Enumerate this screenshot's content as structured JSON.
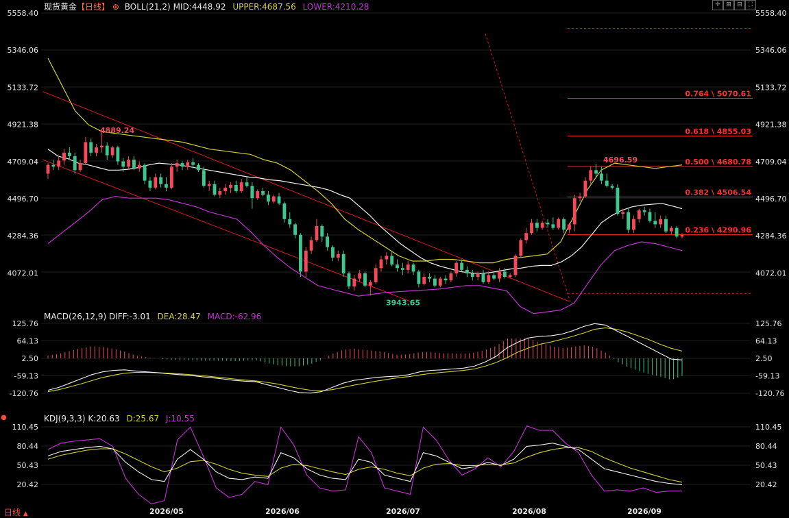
{
  "header": {
    "instrument": "现货黄金",
    "period": "【日线】",
    "settings_glyph": "⊕",
    "boll": {
      "label": "BOLL(21,2)",
      "mid_label": "MID:4448.92",
      "upper_label": "UPPER:4687.56",
      "lower_label": "LOWER:4210.28"
    }
  },
  "colors": {
    "up": "#f24a5a",
    "down": "#3fc68f",
    "mid": "#f2f2f2",
    "upper": "#d6d030",
    "lower": "#c631d6",
    "fib": "#ff2222",
    "grid": "#1e1e1e",
    "bg": "#000000"
  },
  "main_panel": {
    "price_ticks": [
      "5558.40",
      "5346.06",
      "5133.72",
      "4921.38",
      "4709.04",
      "4496.70",
      "4284.36",
      "4072.01"
    ],
    "annotations": {
      "high_label": "4889.24",
      "low_label": "3943.65",
      "swing_high_label": "4696.59"
    },
    "fib_levels": [
      {
        "label": "0.764 \\ 5070.61",
        "price": 5070.61
      },
      {
        "label": "0.618 \\ 4855.03",
        "price": 4855.03
      },
      {
        "label": "0.500 \\ 4680.78",
        "price": 4680.78
      },
      {
        "label": "0.382 \\ 4506.54",
        "price": 4506.54
      },
      {
        "label": "0.236 \\ 4290.96",
        "price": 4290.96
      }
    ]
  },
  "macd_panel": {
    "label": "MACD(26,12,9)",
    "diff_label": "DIFF:-3.01",
    "dea_label": "DEA:28.47",
    "macd_label": "MACD:-62.96",
    "ticks": [
      "125.76",
      "64.13",
      "2.50",
      "-59.13",
      "-120.76"
    ]
  },
  "kdj_panel": {
    "label": "KDJ(9,3,3)",
    "k_label": "K:20.63",
    "d_label": "D:25.67",
    "j_label": "J:10.55",
    "ticks": [
      "110.45",
      "80.44",
      "50.43",
      "20.42"
    ]
  },
  "x_axis": {
    "labels": [
      "2026/05",
      "2026/06",
      "2026/07",
      "2026/08",
      "2026/09"
    ]
  },
  "footer": {
    "period_label": "日线",
    "arrow": "▲"
  },
  "chart_data": {
    "type": "candlestick",
    "candles": [
      {
        "o": 4640,
        "h": 4700,
        "l": 4610,
        "c": 4690
      },
      {
        "o": 4690,
        "h": 4720,
        "l": 4660,
        "c": 4680
      },
      {
        "o": 4680,
        "h": 4740,
        "l": 4660,
        "c": 4715
      },
      {
        "o": 4715,
        "h": 4780,
        "l": 4690,
        "c": 4760
      },
      {
        "o": 4760,
        "h": 4790,
        "l": 4720,
        "c": 4740
      },
      {
        "o": 4740,
        "h": 4760,
        "l": 4640,
        "c": 4660
      },
      {
        "o": 4660,
        "h": 4720,
        "l": 4650,
        "c": 4700
      },
      {
        "o": 4700,
        "h": 4850,
        "l": 4690,
        "c": 4820
      },
      {
        "o": 4820,
        "h": 4840,
        "l": 4740,
        "c": 4760
      },
      {
        "o": 4760,
        "h": 4810,
        "l": 4740,
        "c": 4790
      },
      {
        "o": 4790,
        "h": 4889,
        "l": 4760,
        "c": 4800
      },
      {
        "o": 4800,
        "h": 4820,
        "l": 4720,
        "c": 4745
      },
      {
        "o": 4745,
        "h": 4800,
        "l": 4730,
        "c": 4790
      },
      {
        "o": 4790,
        "h": 4800,
        "l": 4690,
        "c": 4710
      },
      {
        "o": 4710,
        "h": 4730,
        "l": 4650,
        "c": 4680
      },
      {
        "o": 4680,
        "h": 4740,
        "l": 4660,
        "c": 4720
      },
      {
        "o": 4720,
        "h": 4740,
        "l": 4660,
        "c": 4670
      },
      {
        "o": 4670,
        "h": 4710,
        "l": 4650,
        "c": 4690
      },
      {
        "o": 4690,
        "h": 4700,
        "l": 4580,
        "c": 4600
      },
      {
        "o": 4600,
        "h": 4620,
        "l": 4540,
        "c": 4560
      },
      {
        "o": 4560,
        "h": 4640,
        "l": 4550,
        "c": 4620
      },
      {
        "o": 4620,
        "h": 4640,
        "l": 4560,
        "c": 4580
      },
      {
        "o": 4580,
        "h": 4620,
        "l": 4540,
        "c": 4560
      },
      {
        "o": 4560,
        "h": 4700,
        "l": 4550,
        "c": 4680
      },
      {
        "o": 4680,
        "h": 4720,
        "l": 4650,
        "c": 4700
      },
      {
        "o": 4700,
        "h": 4710,
        "l": 4660,
        "c": 4680
      },
      {
        "o": 4680,
        "h": 4720,
        "l": 4660,
        "c": 4705
      },
      {
        "o": 4705,
        "h": 4730,
        "l": 4670,
        "c": 4690
      },
      {
        "o": 4690,
        "h": 4700,
        "l": 4650,
        "c": 4660
      },
      {
        "o": 4660,
        "h": 4680,
        "l": 4560,
        "c": 4570
      },
      {
        "o": 4570,
        "h": 4600,
        "l": 4540,
        "c": 4580
      },
      {
        "o": 4580,
        "h": 4600,
        "l": 4510,
        "c": 4520
      },
      {
        "o": 4520,
        "h": 4560,
        "l": 4500,
        "c": 4540
      },
      {
        "o": 4540,
        "h": 4580,
        "l": 4520,
        "c": 4560
      },
      {
        "o": 4560,
        "h": 4590,
        "l": 4530,
        "c": 4575
      },
      {
        "o": 4575,
        "h": 4600,
        "l": 4530,
        "c": 4540
      },
      {
        "o": 4540,
        "h": 4610,
        "l": 4530,
        "c": 4590
      },
      {
        "o": 4590,
        "h": 4620,
        "l": 4560,
        "c": 4570
      },
      {
        "o": 4570,
        "h": 4590,
        "l": 4440,
        "c": 4500
      },
      {
        "o": 4500,
        "h": 4550,
        "l": 4490,
        "c": 4540
      },
      {
        "o": 4540,
        "h": 4560,
        "l": 4510,
        "c": 4520
      },
      {
        "o": 4520,
        "h": 4540,
        "l": 4460,
        "c": 4480
      },
      {
        "o": 4480,
        "h": 4520,
        "l": 4470,
        "c": 4510
      },
      {
        "o": 4510,
        "h": 4530,
        "l": 4460,
        "c": 4470
      },
      {
        "o": 4470,
        "h": 4480,
        "l": 4360,
        "c": 4380
      },
      {
        "o": 4380,
        "h": 4420,
        "l": 4330,
        "c": 4350
      },
      {
        "o": 4350,
        "h": 4360,
        "l": 4270,
        "c": 4290
      },
      {
        "o": 4290,
        "h": 4300,
        "l": 4050,
        "c": 4080
      },
      {
        "o": 4080,
        "h": 4220,
        "l": 4050,
        "c": 4200
      },
      {
        "o": 4200,
        "h": 4280,
        "l": 4180,
        "c": 4260
      },
      {
        "o": 4260,
        "h": 4380,
        "l": 4250,
        "c": 4340
      },
      {
        "o": 4340,
        "h": 4350,
        "l": 4250,
        "c": 4280
      },
      {
        "o": 4280,
        "h": 4300,
        "l": 4200,
        "c": 4220
      },
      {
        "o": 4220,
        "h": 4230,
        "l": 4140,
        "c": 4160
      },
      {
        "o": 4160,
        "h": 4200,
        "l": 4140,
        "c": 4180
      },
      {
        "o": 4180,
        "h": 4200,
        "l": 4050,
        "c": 4070
      },
      {
        "o": 4070,
        "h": 4080,
        "l": 3980,
        "c": 3995
      },
      {
        "o": 3995,
        "h": 4060,
        "l": 3970,
        "c": 4040
      },
      {
        "o": 4040,
        "h": 4090,
        "l": 4020,
        "c": 4070
      },
      {
        "o": 4070,
        "h": 4080,
        "l": 3990,
        "c": 4000
      },
      {
        "o": 4000,
        "h": 4030,
        "l": 3943,
        "c": 4020
      },
      {
        "o": 4020,
        "h": 4120,
        "l": 4010,
        "c": 4100
      },
      {
        "o": 4100,
        "h": 4170,
        "l": 4080,
        "c": 4150
      },
      {
        "o": 4150,
        "h": 4190,
        "l": 4120,
        "c": 4170
      },
      {
        "o": 4170,
        "h": 4200,
        "l": 4110,
        "c": 4120
      },
      {
        "o": 4120,
        "h": 4150,
        "l": 4080,
        "c": 4100
      },
      {
        "o": 4100,
        "h": 4130,
        "l": 4060,
        "c": 4090
      },
      {
        "o": 4090,
        "h": 4140,
        "l": 4070,
        "c": 4120
      },
      {
        "o": 4120,
        "h": 4130,
        "l": 4060,
        "c": 4080
      },
      {
        "o": 4080,
        "h": 4090,
        "l": 3990,
        "c": 4010
      },
      {
        "o": 4010,
        "h": 4070,
        "l": 4000,
        "c": 4050
      },
      {
        "o": 4050,
        "h": 4070,
        "l": 4020,
        "c": 4040
      },
      {
        "o": 4040,
        "h": 4060,
        "l": 3990,
        "c": 4000
      },
      {
        "o": 4000,
        "h": 4050,
        "l": 3990,
        "c": 4040
      },
      {
        "o": 4040,
        "h": 4060,
        "l": 4010,
        "c": 4030
      },
      {
        "o": 4030,
        "h": 4080,
        "l": 4020,
        "c": 4070
      },
      {
        "o": 4070,
        "h": 4140,
        "l": 4050,
        "c": 4130
      },
      {
        "o": 4130,
        "h": 4150,
        "l": 4080,
        "c": 4090
      },
      {
        "o": 4090,
        "h": 4110,
        "l": 4050,
        "c": 4070
      },
      {
        "o": 4070,
        "h": 4090,
        "l": 4030,
        "c": 4050
      },
      {
        "o": 4050,
        "h": 4080,
        "l": 4030,
        "c": 4070
      },
      {
        "o": 4070,
        "h": 4090,
        "l": 4010,
        "c": 4020
      },
      {
        "o": 4020,
        "h": 4080,
        "l": 4010,
        "c": 4060
      },
      {
        "o": 4060,
        "h": 4080,
        "l": 4030,
        "c": 4040
      },
      {
        "o": 4040,
        "h": 4100,
        "l": 4020,
        "c": 4080
      },
      {
        "o": 4080,
        "h": 4100,
        "l": 4040,
        "c": 4050
      },
      {
        "o": 4050,
        "h": 4070,
        "l": 4040,
        "c": 4060
      },
      {
        "o": 4060,
        "h": 4180,
        "l": 4050,
        "c": 4170
      },
      {
        "o": 4170,
        "h": 4270,
        "l": 4160,
        "c": 4260
      },
      {
        "o": 4260,
        "h": 4330,
        "l": 4240,
        "c": 4300
      },
      {
        "o": 4300,
        "h": 4380,
        "l": 4290,
        "c": 4360
      },
      {
        "o": 4360,
        "h": 4380,
        "l": 4310,
        "c": 4330
      },
      {
        "o": 4330,
        "h": 4370,
        "l": 4320,
        "c": 4360
      },
      {
        "o": 4360,
        "h": 4380,
        "l": 4330,
        "c": 4350
      },
      {
        "o": 4350,
        "h": 4390,
        "l": 4320,
        "c": 4330
      },
      {
        "o": 4330,
        "h": 4390,
        "l": 4320,
        "c": 4380
      },
      {
        "o": 4380,
        "h": 4390,
        "l": 4300,
        "c": 4320
      },
      {
        "o": 4320,
        "h": 4360,
        "l": 4300,
        "c": 4350
      },
      {
        "o": 4350,
        "h": 4520,
        "l": 4310,
        "c": 4500
      },
      {
        "o": 4500,
        "h": 4530,
        "l": 4480,
        "c": 4510
      },
      {
        "o": 4510,
        "h": 4620,
        "l": 4500,
        "c": 4600
      },
      {
        "o": 4600,
        "h": 4680,
        "l": 4580,
        "c": 4660
      },
      {
        "o": 4660,
        "h": 4696,
        "l": 4620,
        "c": 4640
      },
      {
        "o": 4640,
        "h": 4680,
        "l": 4580,
        "c": 4600
      },
      {
        "o": 4600,
        "h": 4640,
        "l": 4560,
        "c": 4570
      },
      {
        "o": 4570,
        "h": 4580,
        "l": 4550,
        "c": 4560
      },
      {
        "o": 4560,
        "h": 4580,
        "l": 4400,
        "c": 4410
      },
      {
        "o": 4410,
        "h": 4440,
        "l": 4380,
        "c": 4420
      },
      {
        "o": 4420,
        "h": 4440,
        "l": 4300,
        "c": 4320
      },
      {
        "o": 4320,
        "h": 4400,
        "l": 4300,
        "c": 4380
      },
      {
        "o": 4380,
        "h": 4440,
        "l": 4360,
        "c": 4430
      },
      {
        "o": 4430,
        "h": 4450,
        "l": 4400,
        "c": 4420
      },
      {
        "o": 4420,
        "h": 4440,
        "l": 4360,
        "c": 4370
      },
      {
        "o": 4370,
        "h": 4420,
        "l": 4330,
        "c": 4350
      },
      {
        "o": 4350,
        "h": 4400,
        "l": 4330,
        "c": 4380
      },
      {
        "o": 4380,
        "h": 4400,
        "l": 4300,
        "c": 4310
      },
      {
        "o": 4310,
        "h": 4340,
        "l": 4290,
        "c": 4330
      },
      {
        "o": 4330,
        "h": 4340,
        "l": 4270,
        "c": 4280
      },
      {
        "o": 4280,
        "h": 4300,
        "l": 4270,
        "c": 4290
      }
    ],
    "boll_mid": [
      4780,
      4740,
      4725,
      4700,
      4690,
      4675,
      4660,
      4660,
      4665,
      4675,
      4690,
      4700,
      4695,
      4690,
      4680,
      4670,
      4660,
      4650,
      4640,
      4630,
      4620,
      4615,
      4605,
      4600,
      4590,
      4580,
      4570,
      4560,
      4545,
      4520,
      4500,
      4450,
      4400,
      4340,
      4290,
      4240,
      4200,
      4160,
      4130,
      4110,
      4095,
      4080,
      4072,
      4068,
      4075,
      4085,
      4095,
      4100,
      4110,
      4115,
      4115,
      4135,
      4170,
      4220,
      4290,
      4360,
      4400,
      4430,
      4450,
      4460,
      4465,
      4470,
      4455,
      4440
    ],
    "boll_upper": [
      5300,
      5150,
      5000,
      4920,
      4880,
      4870,
      4860,
      4850,
      4840,
      4830,
      4820,
      4800,
      4780,
      4770,
      4760,
      4750,
      4720,
      4700,
      4660,
      4600,
      4540,
      4470,
      4380,
      4320,
      4270,
      4220,
      4170,
      4140,
      4140,
      4150,
      4150,
      4140,
      4130,
      4130,
      4150,
      4160,
      4170,
      4180,
      4250,
      4400,
      4550,
      4660,
      4700,
      4690,
      4680,
      4670,
      4680,
      4690
    ],
    "boll_lower": [
      4240,
      4300,
      4360,
      4420,
      4490,
      4510,
      4500,
      4500,
      4500,
      4490,
      4470,
      4450,
      4420,
      4400,
      4380,
      4310,
      4230,
      4160,
      4100,
      4050,
      4000,
      3980,
      3960,
      3940,
      3950,
      3960,
      3965,
      3970,
      3975,
      3980,
      3990,
      4000,
      4000,
      3985,
      3970,
      3880,
      3840,
      3850,
      3860,
      3900,
      4010,
      4120,
      4200,
      4230,
      4250,
      4240,
      4220,
      4200
    ],
    "fib_retracement": [
      {
        "ratio": "0.764",
        "price": 5070.61
      },
      {
        "ratio": "0.618",
        "price": 4855.03
      },
      {
        "ratio": "0.500",
        "price": 4680.78
      },
      {
        "ratio": "0.382",
        "price": 4506.54
      },
      {
        "ratio": "0.236",
        "price": 4290.96
      }
    ],
    "macd": {
      "diff": [
        -110,
        -100,
        -85,
        -70,
        -55,
        -45,
        -40,
        -38,
        -42,
        -45,
        -48,
        -52,
        -55,
        -58,
        -62,
        -66,
        -70,
        -75,
        -78,
        -80,
        -90,
        -100,
        -110,
        -118,
        -120,
        -115,
        -100,
        -85,
        -75,
        -70,
        -65,
        -62,
        -60,
        -55,
        -45,
        -40,
        -38,
        -35,
        -32,
        -25,
        -10,
        10,
        40,
        60,
        75,
        80,
        82,
        88,
        100,
        115,
        125,
        120,
        100,
        80,
        60,
        40,
        20,
        0,
        -3
      ],
      "dea": [
        -115,
        -108,
        -98,
        -88,
        -76,
        -65,
        -57,
        -50,
        -47,
        -47,
        -48,
        -50,
        -52,
        -55,
        -58,
        -62,
        -66,
        -70,
        -74,
        -77,
        -82,
        -88,
        -96,
        -104,
        -110,
        -112,
        -108,
        -100,
        -92,
        -85,
        -78,
        -72,
        -66,
        -62,
        -56,
        -51,
        -47,
        -44,
        -40,
        -35,
        -25,
        -12,
        5,
        25,
        40,
        52,
        60,
        70,
        80,
        92,
        105,
        110,
        105,
        95,
        82,
        68,
        52,
        38,
        28
      ]
    },
    "kdj": {
      "k": [
        65,
        72,
        75,
        78,
        80,
        76,
        55,
        40,
        28,
        25,
        60,
        75,
        60,
        40,
        30,
        28,
        32,
        30,
        70,
        62,
        45,
        35,
        30,
        28,
        60,
        55,
        35,
        30,
        25,
        70,
        65,
        55,
        45,
        48,
        55,
        50,
        60,
        80,
        82,
        85,
        80,
        75,
        60,
        45,
        40,
        35,
        30,
        25,
        22,
        20
      ],
      "d": [
        60,
        66,
        70,
        74,
        76,
        76,
        68,
        58,
        48,
        40,
        46,
        56,
        58,
        52,
        44,
        38,
        35,
        33,
        46,
        52,
        50,
        45,
        40,
        36,
        44,
        48,
        44,
        38,
        34,
        46,
        52,
        53,
        50,
        50,
        52,
        51,
        54,
        63,
        70,
        75,
        78,
        78,
        72,
        62,
        54,
        46,
        40,
        34,
        28,
        24
      ],
      "j": [
        75,
        85,
        88,
        90,
        92,
        80,
        30,
        5,
        -10,
        -5,
        90,
        110,
        65,
        15,
        0,
        5,
        25,
        20,
        110,
        82,
        35,
        15,
        10,
        12,
        95,
        70,
        15,
        10,
        5,
        110,
        90,
        58,
        35,
        45,
        62,
        48,
        72,
        112,
        105,
        105,
        85,
        70,
        35,
        10,
        12,
        10,
        15,
        8,
        10,
        10
      ]
    }
  }
}
